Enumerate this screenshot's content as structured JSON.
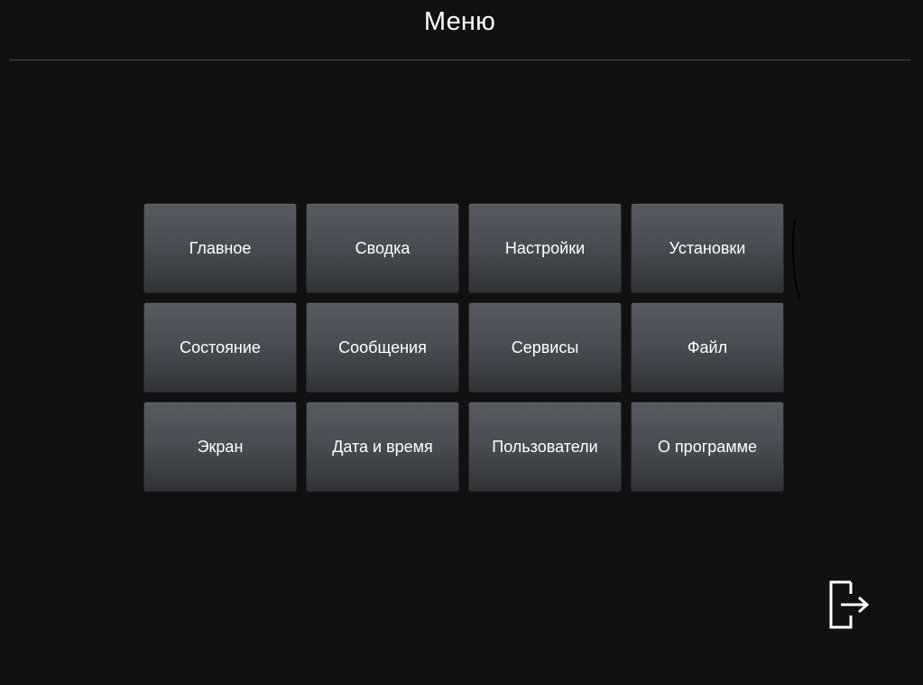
{
  "header": {
    "title": "Меню"
  },
  "menu": {
    "items": [
      {
        "id": "main",
        "label": "Главное"
      },
      {
        "id": "summary",
        "label": "Сводка"
      },
      {
        "id": "settings",
        "label": "Настройки"
      },
      {
        "id": "setpoints",
        "label": "Установки"
      },
      {
        "id": "status",
        "label": "Состояние"
      },
      {
        "id": "messages",
        "label": "Сообщения"
      },
      {
        "id": "services",
        "label": "Сервисы"
      },
      {
        "id": "file",
        "label": "Файл"
      },
      {
        "id": "screen",
        "label": "Экран"
      },
      {
        "id": "datetime",
        "label": "Дата и время"
      },
      {
        "id": "users",
        "label": "Пользователи"
      },
      {
        "id": "about",
        "label": "О программе"
      }
    ]
  },
  "logout": {
    "icon": "logout-icon"
  },
  "colors": {
    "background": "#111111",
    "button_top": "#575b61",
    "button_bottom": "#2f3236",
    "divider": "#4a4a4a",
    "text": "#ffffff"
  }
}
